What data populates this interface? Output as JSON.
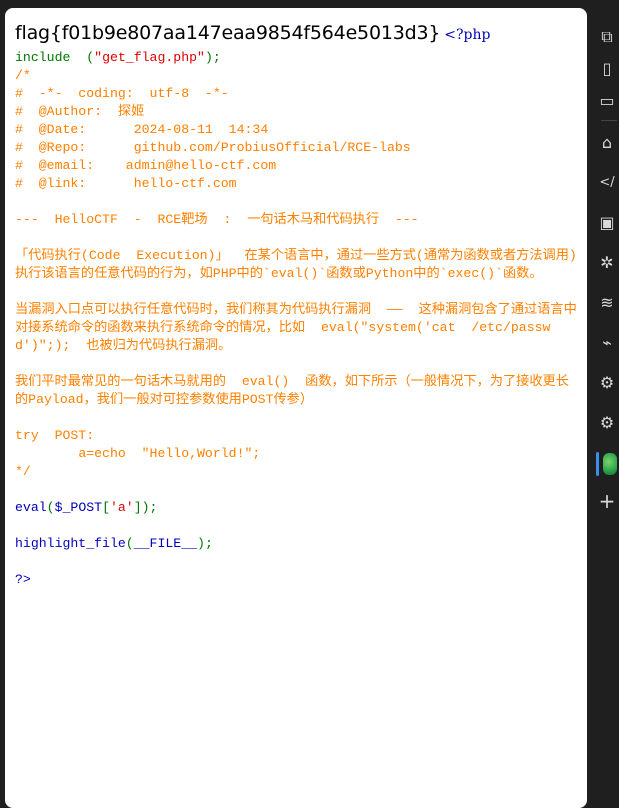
{
  "flag_text": "flag{f01b9e807aa147eaa9854f564e5013d3}",
  "php_open": "<?php",
  "code": {
    "include_kw": "include",
    "include_open": "  (",
    "include_str": "\"get_flag.php\"",
    "include_close": ");",
    "comment_lines": [
      "/*",
      "#  -*-  coding:  utf-8  -*-",
      "#  @Author:  探姬",
      "#  @Date:      2024-08-11  14:34",
      "#  @Repo:      github.com/ProbiusOfficial/RCE-labs",
      "#  @email:    admin@hello-ctf.com",
      "#  @link:      hello-ctf.com",
      "",
      "---  HelloCTF  -  RCE靶场  :  一句话木马和代码执行  ---",
      "",
      "「代码执行(Code  Execution)」  在某个语言中，通过一些方式(通常为函数或者方法调用)执行该语言的任意代码的行为，如PHP中的`eval()`函数或Python中的`exec()`函数。",
      "",
      "当漏洞入口点可以执行任意代码时，我们称其为代码执行漏洞  ——  这种漏洞包含了通过语言中对接系统命令的函数来执行系统命令的情况，比如  eval(\"system('cat  /etc/passwd')\";);  也被归为代码执行漏洞。",
      "",
      "我们平时最常见的一句话木马就用的  eval()  函数，如下所示（一般情况下，为了接收更长的Payload，我们一般对可控参数使用POST传参）",
      "",
      "try  POST:",
      "        a=echo  \"Hello,World!\";",
      "*/"
    ],
    "eval_fn": "eval",
    "eval_open": "(",
    "eval_var": "$_POST",
    "eval_bracket_open": "[",
    "eval_key": "'a'",
    "eval_close": "]);",
    "highlight_fn": "highlight_file",
    "highlight_open": "(",
    "highlight_arg": "__FILE__",
    "highlight_close": ");",
    "php_close": "?>"
  },
  "sidebar": {
    "icons": [
      "copy-icon",
      "tablet-icon",
      "window-icon",
      "home-icon",
      "code-icon",
      "terminal-icon",
      "bug-icon",
      "wifi-icon",
      "spray-icon",
      "chip-icon",
      "app-icon",
      "add-icon"
    ],
    "glyphs": {
      "copy": "⧉",
      "tablet": "▯",
      "window": "▭",
      "home": "⌂",
      "code": "</",
      "terminal": "▣",
      "bug": "✲",
      "wifi": "≋",
      "spray": "⌁",
      "chip": "⚙",
      "add": "+"
    }
  }
}
